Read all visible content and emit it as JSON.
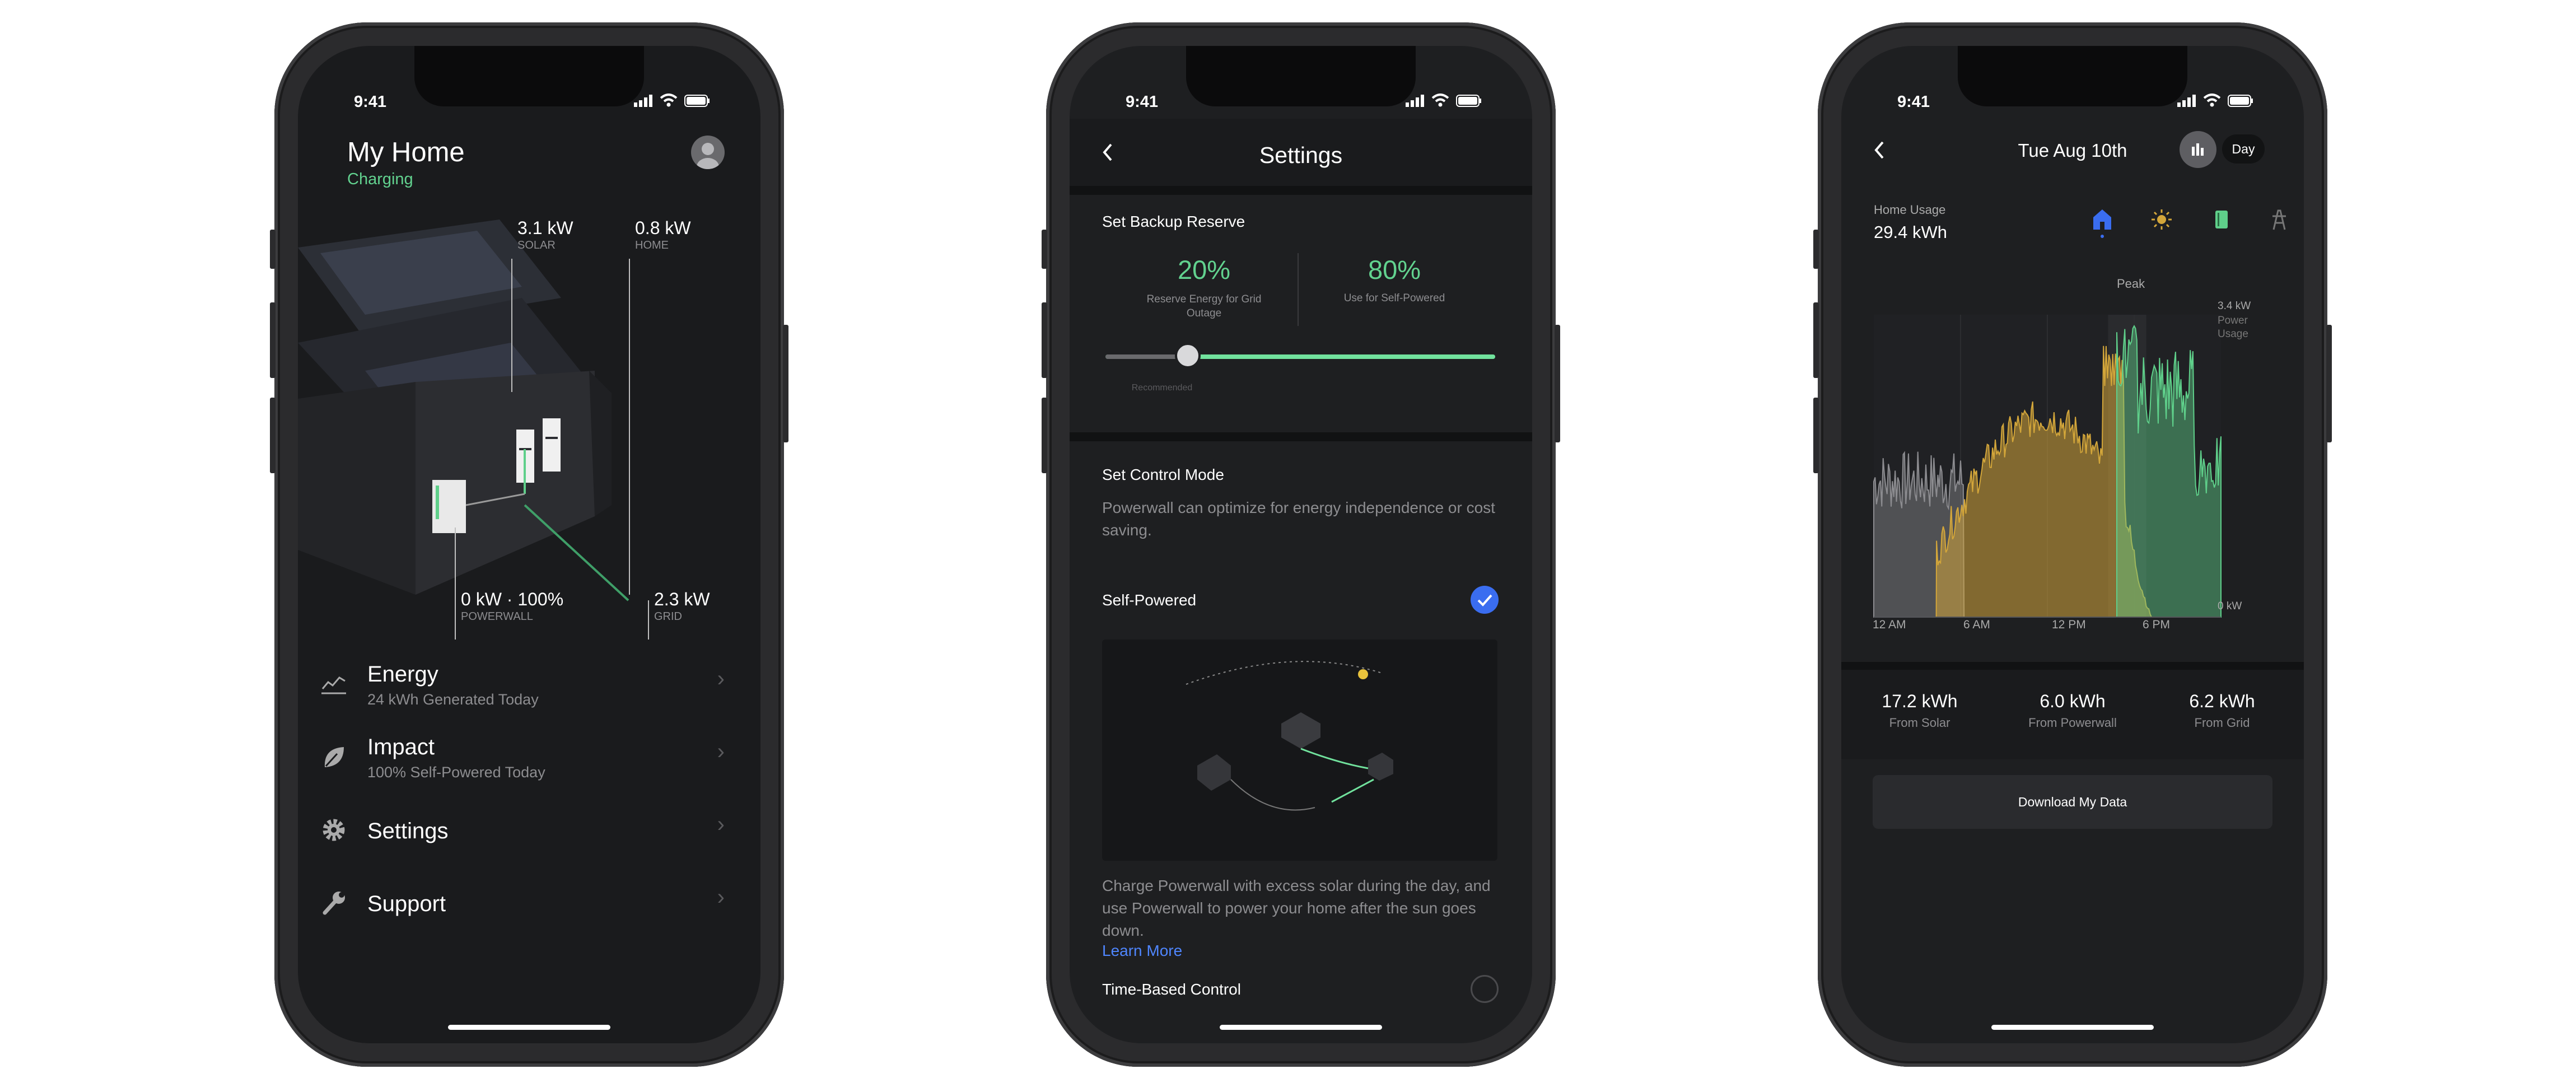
{
  "status": {
    "time": "9:41"
  },
  "home": {
    "title": "My Home",
    "state": "Charging",
    "metrics": {
      "solar_value": "3.1 kW",
      "solar_label": "SOLAR",
      "home_value": "0.8 kW",
      "home_label": "HOME",
      "pw_value": "0 kW · 100%",
      "pw_label": "POWERWALL",
      "grid_value": "2.3 kW",
      "grid_label": "GRID"
    },
    "menu": [
      {
        "label": "Energy",
        "sub": "24 kWh Generated Today",
        "icon": "chart-line-icon"
      },
      {
        "label": "Impact",
        "sub": "100% Self-Powered Today",
        "icon": "leaf-icon"
      },
      {
        "label": "Settings",
        "sub": "",
        "icon": "gear-icon"
      },
      {
        "label": "Support",
        "sub": "",
        "icon": "wrench-icon"
      }
    ]
  },
  "settings": {
    "title": "Settings",
    "backup_title": "Set Backup Reserve",
    "reserve_pct": "20%",
    "reserve_desc": "Reserve Energy for Grid Outage",
    "self_pct": "80%",
    "self_desc": "Use for Self-Powered",
    "slider_value": 0.2,
    "recommended": "Recommended",
    "mode_title": "Set Control Mode",
    "mode_desc": "Powerwall can optimize for energy independence or cost saving.",
    "opt1": "Self-Powered",
    "opt1_desc": "Charge Powerwall with excess solar during the day, and use Powerwall to power your home after the sun goes down.",
    "learn_more": "Learn More",
    "opt2": "Time-Based Control"
  },
  "usage": {
    "date": "Tue Aug 10th",
    "period": "Day",
    "usage_label": "Home Usage",
    "usage_value": "29.4 kWh",
    "peak": "Peak",
    "ymax": "3.4 kW",
    "ylabel1": "Power",
    "ylabel2": "Usage",
    "ymin": "0 kW",
    "xticks": [
      "12 AM",
      "6 AM",
      "12 PM",
      "6 PM"
    ],
    "stats": [
      {
        "value": "17.2 kWh",
        "label": "From Solar"
      },
      {
        "value": "6.0 kWh",
        "label": "From Powerwall"
      },
      {
        "value": "6.2 kWh",
        "label": "From Grid"
      }
    ],
    "download": "Download My Data",
    "colors": {
      "grid": "#8c8c90",
      "solar": "#d3a63a",
      "powerwall": "#5fcf8a",
      "accent": "#3a6df0"
    }
  }
}
